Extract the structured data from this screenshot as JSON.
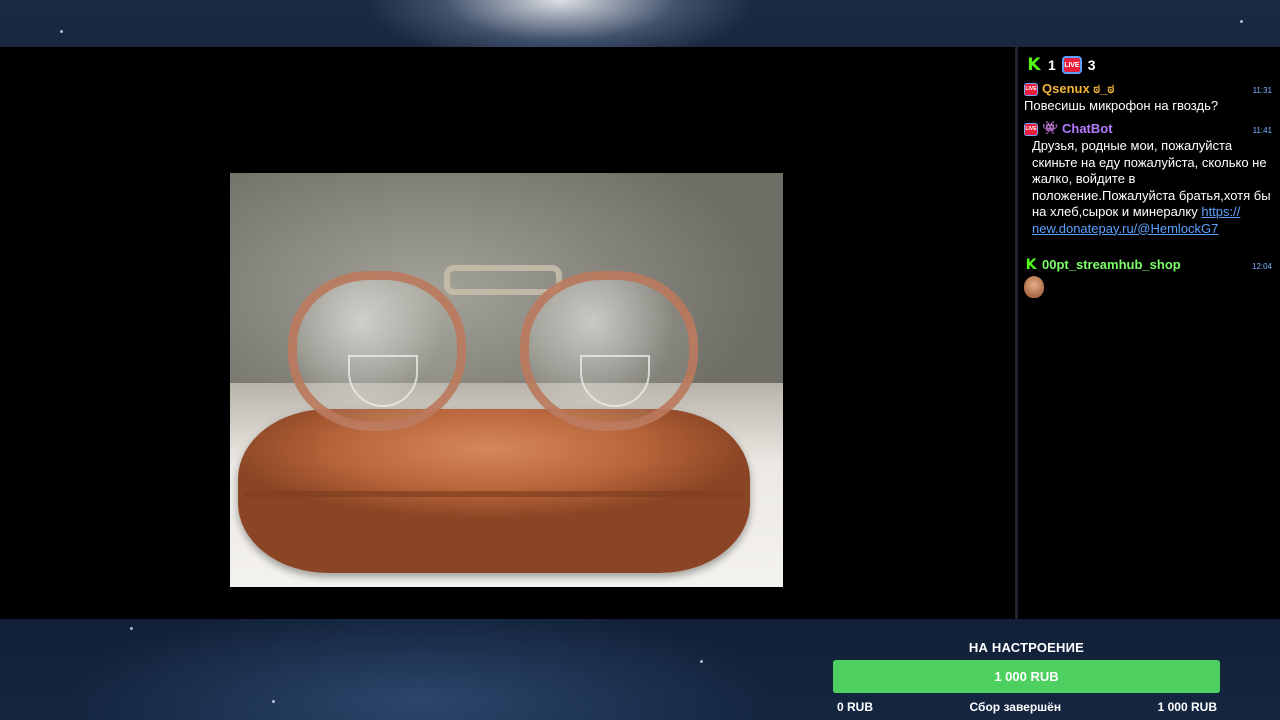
{
  "chat": {
    "header": {
      "kick_count": "1",
      "live_count": "3"
    },
    "messages": [
      {
        "platform_badge": "LIVE",
        "user": "Qsenux ಠ_ಠ",
        "user_color": "#f2b53a",
        "time": "11:31",
        "text": "Повесишь микрофон на гвоздь?"
      },
      {
        "platform_badge": "LIVE",
        "user": "ChatBot",
        "user_color": "#b57bff",
        "time": "11:41",
        "text": "Друзья, родные мои, пожалуйста скиньте на еду пожалуйста, сколько не жалко, войдите в положение.Пожалуйста братья,хотя бы на хлеб,сырок и минералку",
        "link_text": "https:// new.donatepay.ru/@HemlockG7"
      },
      {
        "platform_badge": "K",
        "user": "00pt_streamhub_shop",
        "user_color": "#7dff6a",
        "time": "12:04",
        "text": ""
      }
    ]
  },
  "goal": {
    "title": "НА НАСТРОЕНИЕ",
    "bar_label": "1 000 RUB",
    "progress_fraction": 1.0,
    "min_label": "0 RUB",
    "status": "Сбор завершён",
    "max_label": "1 000 RUB",
    "bar_color": "#47c85a"
  },
  "colors": {
    "accent_link": "#5da2ff",
    "kick_green": "#53fc18",
    "live_red": "#e91e3a",
    "timestamp": "#7fb3ff"
  },
  "icons": {
    "kick": "kick-logo-icon",
    "live": "live-badge-icon",
    "bot": "robot-icon",
    "emote": "face-emote-icon"
  }
}
